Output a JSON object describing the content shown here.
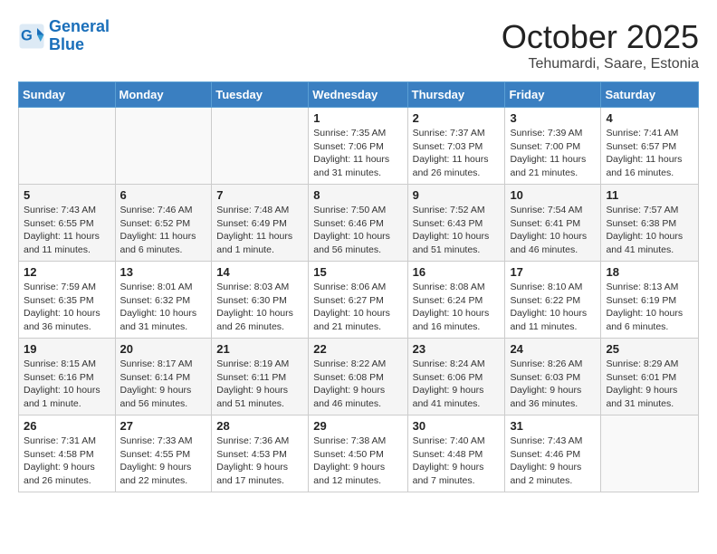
{
  "header": {
    "logo_line1": "General",
    "logo_line2": "Blue",
    "month": "October 2025",
    "location": "Tehumardi, Saare, Estonia"
  },
  "weekdays": [
    "Sunday",
    "Monday",
    "Tuesday",
    "Wednesday",
    "Thursday",
    "Friday",
    "Saturday"
  ],
  "weeks": [
    [
      {
        "day": "",
        "info": ""
      },
      {
        "day": "",
        "info": ""
      },
      {
        "day": "",
        "info": ""
      },
      {
        "day": "1",
        "info": "Sunrise: 7:35 AM\nSunset: 7:06 PM\nDaylight: 11 hours and 31 minutes."
      },
      {
        "day": "2",
        "info": "Sunrise: 7:37 AM\nSunset: 7:03 PM\nDaylight: 11 hours and 26 minutes."
      },
      {
        "day": "3",
        "info": "Sunrise: 7:39 AM\nSunset: 7:00 PM\nDaylight: 11 hours and 21 minutes."
      },
      {
        "day": "4",
        "info": "Sunrise: 7:41 AM\nSunset: 6:57 PM\nDaylight: 11 hours and 16 minutes."
      }
    ],
    [
      {
        "day": "5",
        "info": "Sunrise: 7:43 AM\nSunset: 6:55 PM\nDaylight: 11 hours and 11 minutes."
      },
      {
        "day": "6",
        "info": "Sunrise: 7:46 AM\nSunset: 6:52 PM\nDaylight: 11 hours and 6 minutes."
      },
      {
        "day": "7",
        "info": "Sunrise: 7:48 AM\nSunset: 6:49 PM\nDaylight: 11 hours and 1 minute."
      },
      {
        "day": "8",
        "info": "Sunrise: 7:50 AM\nSunset: 6:46 PM\nDaylight: 10 hours and 56 minutes."
      },
      {
        "day": "9",
        "info": "Sunrise: 7:52 AM\nSunset: 6:43 PM\nDaylight: 10 hours and 51 minutes."
      },
      {
        "day": "10",
        "info": "Sunrise: 7:54 AM\nSunset: 6:41 PM\nDaylight: 10 hours and 46 minutes."
      },
      {
        "day": "11",
        "info": "Sunrise: 7:57 AM\nSunset: 6:38 PM\nDaylight: 10 hours and 41 minutes."
      }
    ],
    [
      {
        "day": "12",
        "info": "Sunrise: 7:59 AM\nSunset: 6:35 PM\nDaylight: 10 hours and 36 minutes."
      },
      {
        "day": "13",
        "info": "Sunrise: 8:01 AM\nSunset: 6:32 PM\nDaylight: 10 hours and 31 minutes."
      },
      {
        "day": "14",
        "info": "Sunrise: 8:03 AM\nSunset: 6:30 PM\nDaylight: 10 hours and 26 minutes."
      },
      {
        "day": "15",
        "info": "Sunrise: 8:06 AM\nSunset: 6:27 PM\nDaylight: 10 hours and 21 minutes."
      },
      {
        "day": "16",
        "info": "Sunrise: 8:08 AM\nSunset: 6:24 PM\nDaylight: 10 hours and 16 minutes."
      },
      {
        "day": "17",
        "info": "Sunrise: 8:10 AM\nSunset: 6:22 PM\nDaylight: 10 hours and 11 minutes."
      },
      {
        "day": "18",
        "info": "Sunrise: 8:13 AM\nSunset: 6:19 PM\nDaylight: 10 hours and 6 minutes."
      }
    ],
    [
      {
        "day": "19",
        "info": "Sunrise: 8:15 AM\nSunset: 6:16 PM\nDaylight: 10 hours and 1 minute."
      },
      {
        "day": "20",
        "info": "Sunrise: 8:17 AM\nSunset: 6:14 PM\nDaylight: 9 hours and 56 minutes."
      },
      {
        "day": "21",
        "info": "Sunrise: 8:19 AM\nSunset: 6:11 PM\nDaylight: 9 hours and 51 minutes."
      },
      {
        "day": "22",
        "info": "Sunrise: 8:22 AM\nSunset: 6:08 PM\nDaylight: 9 hours and 46 minutes."
      },
      {
        "day": "23",
        "info": "Sunrise: 8:24 AM\nSunset: 6:06 PM\nDaylight: 9 hours and 41 minutes."
      },
      {
        "day": "24",
        "info": "Sunrise: 8:26 AM\nSunset: 6:03 PM\nDaylight: 9 hours and 36 minutes."
      },
      {
        "day": "25",
        "info": "Sunrise: 8:29 AM\nSunset: 6:01 PM\nDaylight: 9 hours and 31 minutes."
      }
    ],
    [
      {
        "day": "26",
        "info": "Sunrise: 7:31 AM\nSunset: 4:58 PM\nDaylight: 9 hours and 26 minutes."
      },
      {
        "day": "27",
        "info": "Sunrise: 7:33 AM\nSunset: 4:55 PM\nDaylight: 9 hours and 22 minutes."
      },
      {
        "day": "28",
        "info": "Sunrise: 7:36 AM\nSunset: 4:53 PM\nDaylight: 9 hours and 17 minutes."
      },
      {
        "day": "29",
        "info": "Sunrise: 7:38 AM\nSunset: 4:50 PM\nDaylight: 9 hours and 12 minutes."
      },
      {
        "day": "30",
        "info": "Sunrise: 7:40 AM\nSunset: 4:48 PM\nDaylight: 9 hours and 7 minutes."
      },
      {
        "day": "31",
        "info": "Sunrise: 7:43 AM\nSunset: 4:46 PM\nDaylight: 9 hours and 2 minutes."
      },
      {
        "day": "",
        "info": ""
      }
    ]
  ]
}
